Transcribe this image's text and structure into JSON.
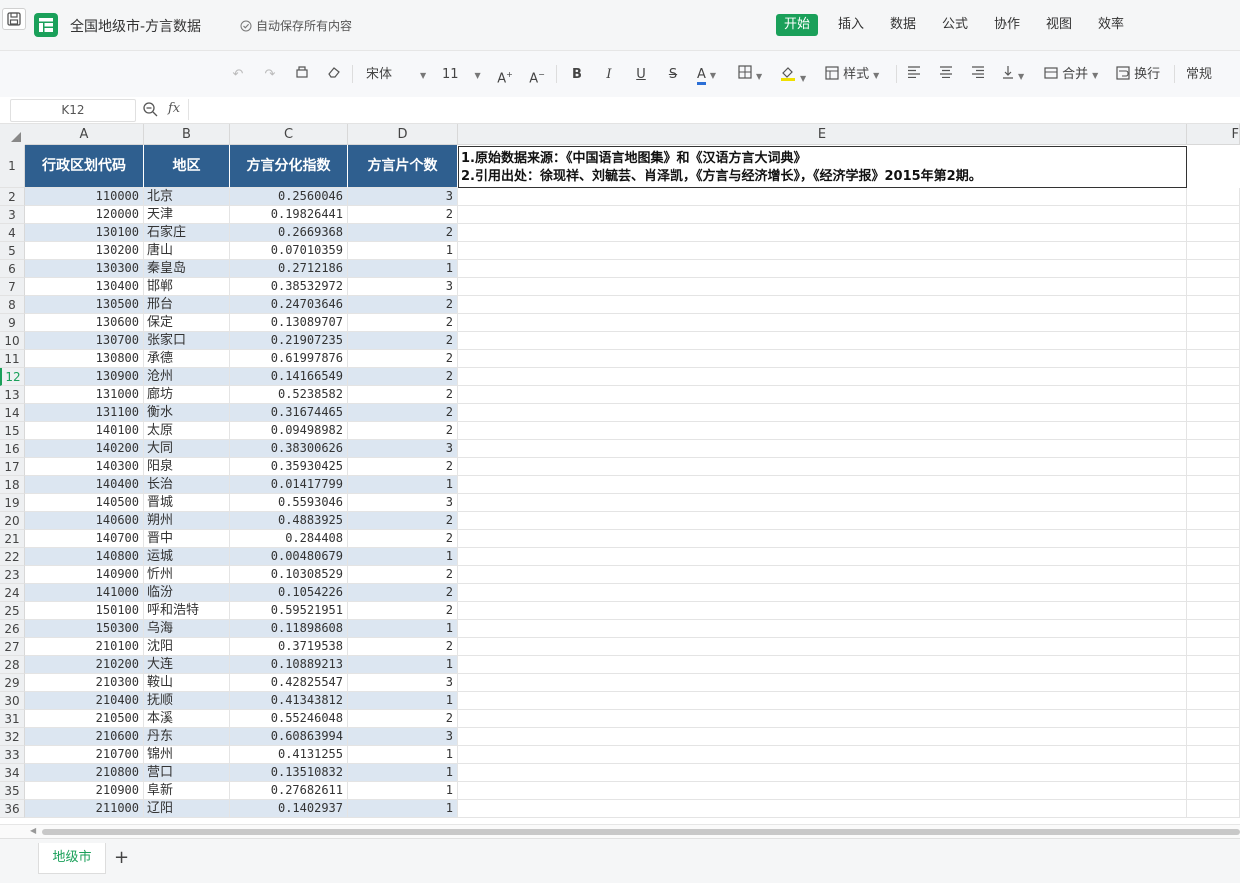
{
  "app": {
    "doc_title": "全国地级市-方言数据",
    "autosave": "自动保存所有内容",
    "menus": [
      "开始",
      "插入",
      "数据",
      "公式",
      "协作",
      "视图",
      "效率"
    ]
  },
  "toolbar": {
    "font": "宋体",
    "size": "11",
    "style": "样式",
    "merge": "合并",
    "wrap": "换行",
    "format": "常规"
  },
  "formula_bar": {
    "cell_ref": "K12",
    "fx": "fx",
    "value": ""
  },
  "columns": [
    "A",
    "B",
    "C",
    "D",
    "E",
    "F"
  ],
  "headers": [
    "行政区划代码",
    "地区",
    "方言分化指数",
    "方言片个数"
  ],
  "note": [
    "1.原始数据来源：《中国语言地图集》和《汉语方言大词典》",
    "2.引用出处：徐现祥、刘毓芸、肖泽凯，《方言与经济增长》，《经济学报》2015年第2期。"
  ],
  "row_numbers": [
    "1",
    "2",
    "3",
    "4",
    "5",
    "6",
    "7",
    "8",
    "9",
    "10",
    "11",
    "12",
    "13",
    "14",
    "15",
    "16",
    "17",
    "18",
    "19",
    "20",
    "21",
    "22",
    "23",
    "24",
    "25",
    "26",
    "27",
    "28",
    "29",
    "30",
    "31",
    "32",
    "33",
    "34",
    "35",
    "36"
  ],
  "rows": [
    {
      "code": "110000",
      "region": "北京",
      "index": "0.2560046",
      "count": "3"
    },
    {
      "code": "120000",
      "region": "天津",
      "index": "0.19826441",
      "count": "2"
    },
    {
      "code": "130100",
      "region": "石家庄",
      "index": "0.2669368",
      "count": "2"
    },
    {
      "code": "130200",
      "region": "唐山",
      "index": "0.07010359",
      "count": "1"
    },
    {
      "code": "130300",
      "region": "秦皇岛",
      "index": "0.2712186",
      "count": "1"
    },
    {
      "code": "130400",
      "region": "邯郸",
      "index": "0.38532972",
      "count": "3"
    },
    {
      "code": "130500",
      "region": "邢台",
      "index": "0.24703646",
      "count": "2"
    },
    {
      "code": "130600",
      "region": "保定",
      "index": "0.13089707",
      "count": "2"
    },
    {
      "code": "130700",
      "region": "张家口",
      "index": "0.21907235",
      "count": "2"
    },
    {
      "code": "130800",
      "region": "承德",
      "index": "0.61997876",
      "count": "2"
    },
    {
      "code": "130900",
      "region": "沧州",
      "index": "0.14166549",
      "count": "2"
    },
    {
      "code": "131000",
      "region": "廊坊",
      "index": "0.5238582",
      "count": "2"
    },
    {
      "code": "131100",
      "region": "衡水",
      "index": "0.31674465",
      "count": "2"
    },
    {
      "code": "140100",
      "region": "太原",
      "index": "0.09498982",
      "count": "2"
    },
    {
      "code": "140200",
      "region": "大同",
      "index": "0.38300626",
      "count": "3"
    },
    {
      "code": "140300",
      "region": "阳泉",
      "index": "0.35930425",
      "count": "2"
    },
    {
      "code": "140400",
      "region": "长治",
      "index": "0.01417799",
      "count": "1"
    },
    {
      "code": "140500",
      "region": "晋城",
      "index": "0.5593046",
      "count": "3"
    },
    {
      "code": "140600",
      "region": "朔州",
      "index": "0.4883925",
      "count": "2"
    },
    {
      "code": "140700",
      "region": "晋中",
      "index": "0.284408",
      "count": "2"
    },
    {
      "code": "140800",
      "region": "运城",
      "index": "0.00480679",
      "count": "1"
    },
    {
      "code": "140900",
      "region": "忻州",
      "index": "0.10308529",
      "count": "2"
    },
    {
      "code": "141000",
      "region": "临汾",
      "index": "0.1054226",
      "count": "2"
    },
    {
      "code": "150100",
      "region": "呼和浩特",
      "index": "0.59521951",
      "count": "2"
    },
    {
      "code": "150300",
      "region": "乌海",
      "index": "0.11898608",
      "count": "1"
    },
    {
      "code": "210100",
      "region": "沈阳",
      "index": "0.3719538",
      "count": "2"
    },
    {
      "code": "210200",
      "region": "大连",
      "index": "0.10889213",
      "count": "1"
    },
    {
      "code": "210300",
      "region": "鞍山",
      "index": "0.42825547",
      "count": "3"
    },
    {
      "code": "210400",
      "region": "抚顺",
      "index": "0.41343812",
      "count": "1"
    },
    {
      "code": "210500",
      "region": "本溪",
      "index": "0.55246048",
      "count": "2"
    },
    {
      "code": "210600",
      "region": "丹东",
      "index": "0.60863994",
      "count": "3"
    },
    {
      "code": "210700",
      "region": "锦州",
      "index": "0.4131255",
      "count": "1"
    },
    {
      "code": "210800",
      "region": "营口",
      "index": "0.13510832",
      "count": "1"
    },
    {
      "code": "210900",
      "region": "阜新",
      "index": "0.27682611",
      "count": "1"
    },
    {
      "code": "211000",
      "region": "辽阳",
      "index": "0.1402937",
      "count": "1"
    }
  ],
  "sheet_tab": "地级市",
  "add_sheet": "+",
  "colors": {
    "accent": "#1aa05a",
    "header_fill": "#2f5f8f",
    "band": "#dce6f1"
  }
}
